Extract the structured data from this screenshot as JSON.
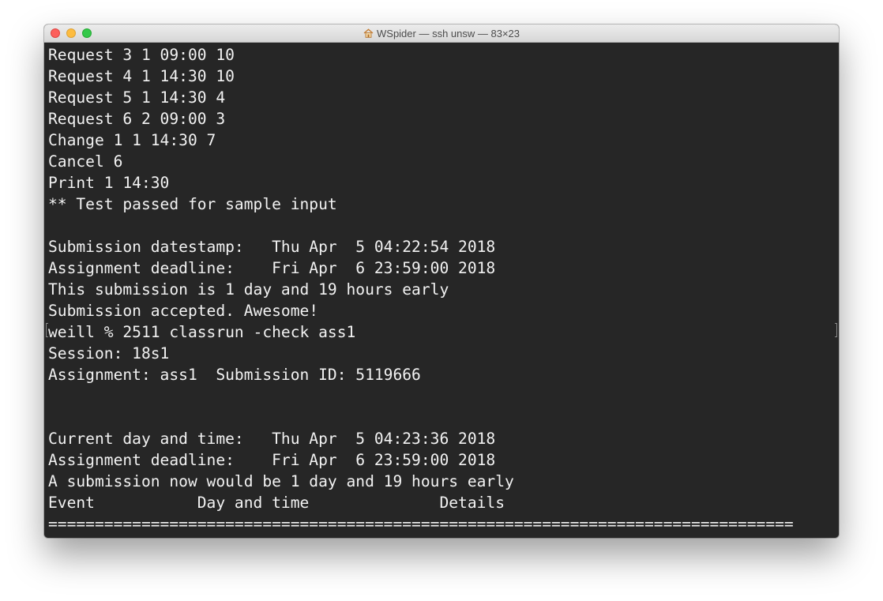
{
  "window": {
    "title": "WSpider — ssh unsw — 83×23",
    "title_icon": "home-icon"
  },
  "terminal": {
    "lines": [
      "Request 3 1 09:00 10",
      "Request 4 1 14:30 10",
      "Request 5 1 14:30 4",
      "Request 6 2 09:00 3",
      "Change 1 1 14:30 7",
      "Cancel 6",
      "Print 1 14:30",
      "** Test passed for sample input",
      "",
      "Submission datestamp:   Thu Apr  5 04:22:54 2018",
      "Assignment deadline:    Fri Apr  6 23:59:00 2018",
      "This submission is 1 day and 19 hours early",
      "Submission accepted. Awesome!",
      "weill % 2511 classrun -check ass1",
      "Session: 18s1",
      "Assignment: ass1  Submission ID: 5119666",
      "",
      "",
      "Current day and time:   Thu Apr  5 04:23:36 2018",
      "Assignment deadline:    Fri Apr  6 23:59:00 2018",
      "A submission now would be 1 day and 19 hours early",
      "Event           Day and time              Details",
      "================================================================================"
    ]
  }
}
